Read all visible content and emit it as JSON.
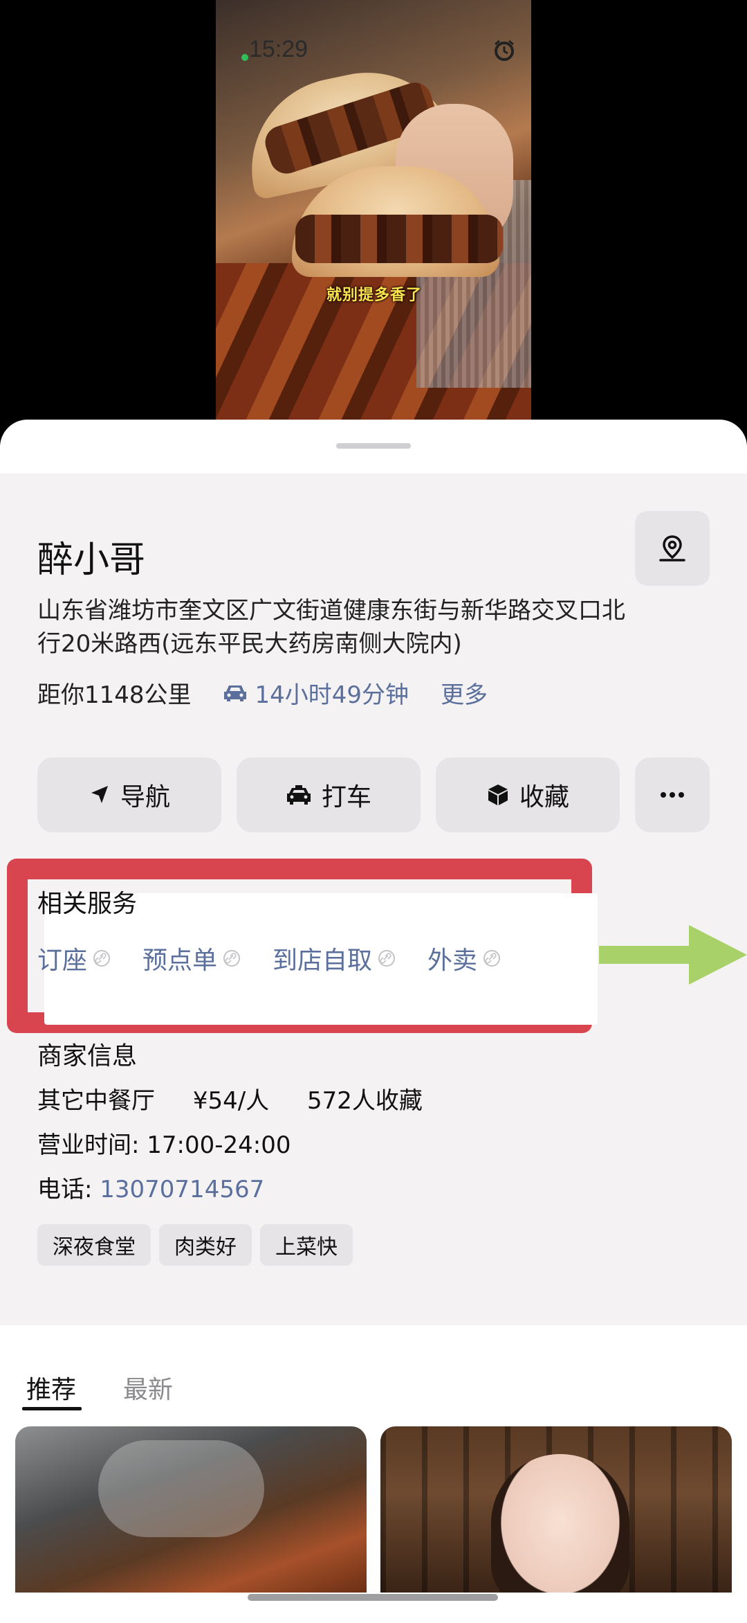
{
  "status_bar": {
    "time": "15:29"
  },
  "video": {
    "caption": "就别提多香了"
  },
  "poi": {
    "name": "醉小哥",
    "address": "山东省潍坊市奎文区广文街道健康东街与新华路交叉口北行20米路西(远东平民大药房南侧大院内)",
    "distance": "距你1148公里",
    "drive_time": "14小时49分钟",
    "more": "更多"
  },
  "actions": [
    {
      "label": "导航",
      "icon": "navigation-arrow-icon"
    },
    {
      "label": "打车",
      "icon": "taxi-icon"
    },
    {
      "label": "收藏",
      "icon": "cube-icon"
    }
  ],
  "related_services": {
    "title": "相关服务",
    "items": [
      "订座",
      "预点单",
      "到店自取",
      "外卖"
    ]
  },
  "merchant": {
    "title": "商家信息",
    "category": "其它中餐厅",
    "price": "¥54/人",
    "favorites": "572人收藏",
    "hours": "营业时间: 17:00-24:00",
    "phone_label": "电话: ",
    "phone": "13070714567",
    "tags": [
      "深夜食堂",
      "肉类好",
      "上菜快"
    ]
  },
  "feed": {
    "tabs": [
      "推荐",
      "最新"
    ]
  },
  "colors": {
    "accent_link": "#5a6f9c",
    "highlight_border": "#d8454e",
    "arrow": "#a9d16a"
  }
}
